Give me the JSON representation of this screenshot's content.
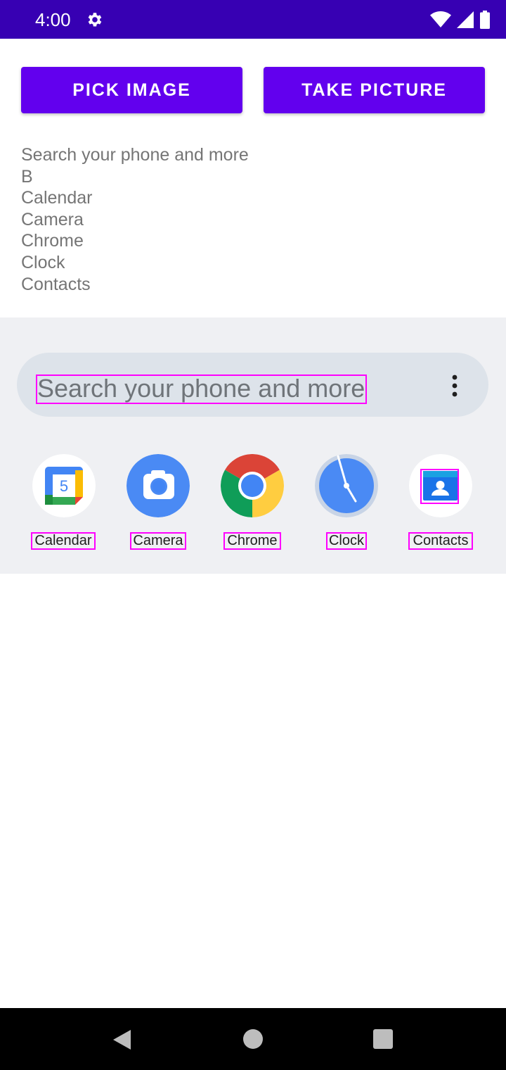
{
  "status_bar": {
    "time": "4:00",
    "icons": [
      "settings-icon",
      "wifi-icon",
      "signal-icon",
      "battery-icon"
    ]
  },
  "buttons": {
    "pick_image": "PICK IMAGE",
    "take_picture": "TAKE PICTURE"
  },
  "results": [
    "Search your phone and more",
    "B",
    "Calendar",
    "Camera",
    "Chrome",
    "Clock",
    "Contacts"
  ],
  "launcher": {
    "search_placeholder": "Search your phone and more",
    "apps": [
      {
        "label": "Calendar",
        "icon": "calendar-icon"
      },
      {
        "label": "Camera",
        "icon": "camera-icon"
      },
      {
        "label": "Chrome",
        "icon": "chrome-icon"
      },
      {
        "label": "Clock",
        "icon": "clock-icon"
      },
      {
        "label": "Contacts",
        "icon": "contacts-icon"
      }
    ],
    "calendar_day": "5"
  },
  "nav_bar": {
    "icons": [
      "back-icon",
      "home-icon",
      "recents-icon"
    ]
  },
  "colors": {
    "status_bar": "#3700b3",
    "button": "#6200ee",
    "launcher_bg": "#eff0f3",
    "search_pill": "#dde3ea"
  }
}
